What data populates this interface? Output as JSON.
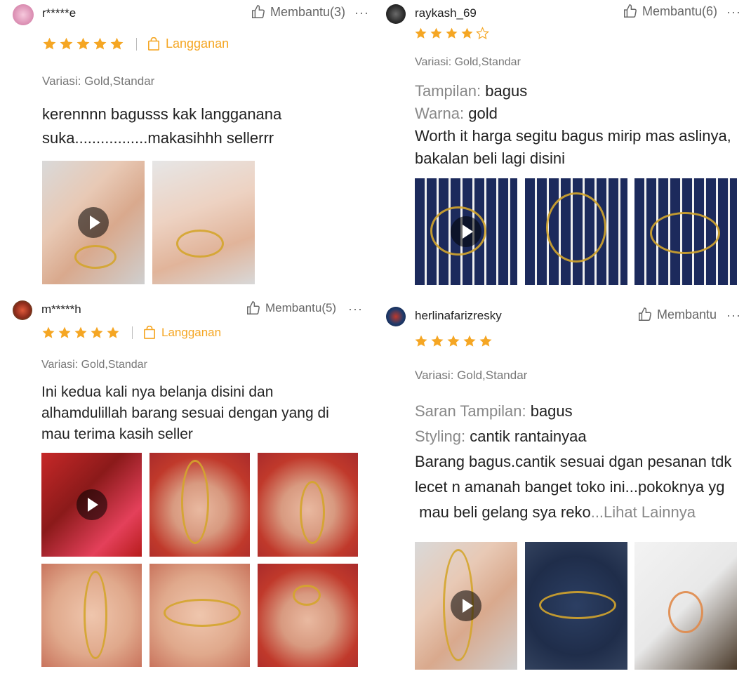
{
  "colors": {
    "star": "#f5a623",
    "subscription": "#f5a623",
    "muted": "#777777"
  },
  "reviews": [
    {
      "username": "r*****e",
      "helpful": "Membantu(3)",
      "more": "···",
      "rating": 5,
      "subscription": "Langganan",
      "variation": "Variasi: Gold,Standar",
      "lines": [
        "kerennnn bagusss kak langganana",
        "suka.................makasihhh sellerrr"
      ],
      "icons": {
        "helpful": "thumbs-up-icon",
        "subscription": "shopping-bag-icon",
        "more": "more-icon"
      }
    },
    {
      "username": "raykash_69",
      "helpful": "Membantu(6)",
      "more": "···",
      "rating": 4,
      "kv": [
        {
          "label": "Tampilan:",
          "value": "bagus"
        },
        {
          "label": "Warna:",
          "value": "gold"
        }
      ],
      "lines": [
        "Worth it harga segitu bagus mirip mas aslinya,",
        "bakalan beli lagi disini"
      ],
      "variation": "Variasi: Gold,Standar"
    },
    {
      "username": "m*****h",
      "helpful": "Membantu(5)",
      "more": "···",
      "rating": 5,
      "subscription": "Langganan",
      "variation": "Variasi: Gold,Standar",
      "lines": [
        "Ini kedua kali nya belanja disini dan",
        "alhamdulillah barang sesuai dengan yang di",
        "mau terima kasih seller"
      ]
    },
    {
      "username": "herlinafarizresky",
      "helpful": "Membantu",
      "more": "···",
      "rating": 5,
      "variation": "Variasi: Gold,Standar",
      "kv": [
        {
          "label": "Saran Tampilan:",
          "value": "bagus"
        },
        {
          "label": "Styling:",
          "value": "cantik rantainyaa"
        }
      ],
      "lines": [
        "Barang bagus.cantik sesuai dgan pesanan tdk",
        "lecet n amanah banget toko ini...pokoknya yg",
        " mau beli gelang sya reko"
      ],
      "see_more": "...Lihat Lainnya"
    }
  ]
}
